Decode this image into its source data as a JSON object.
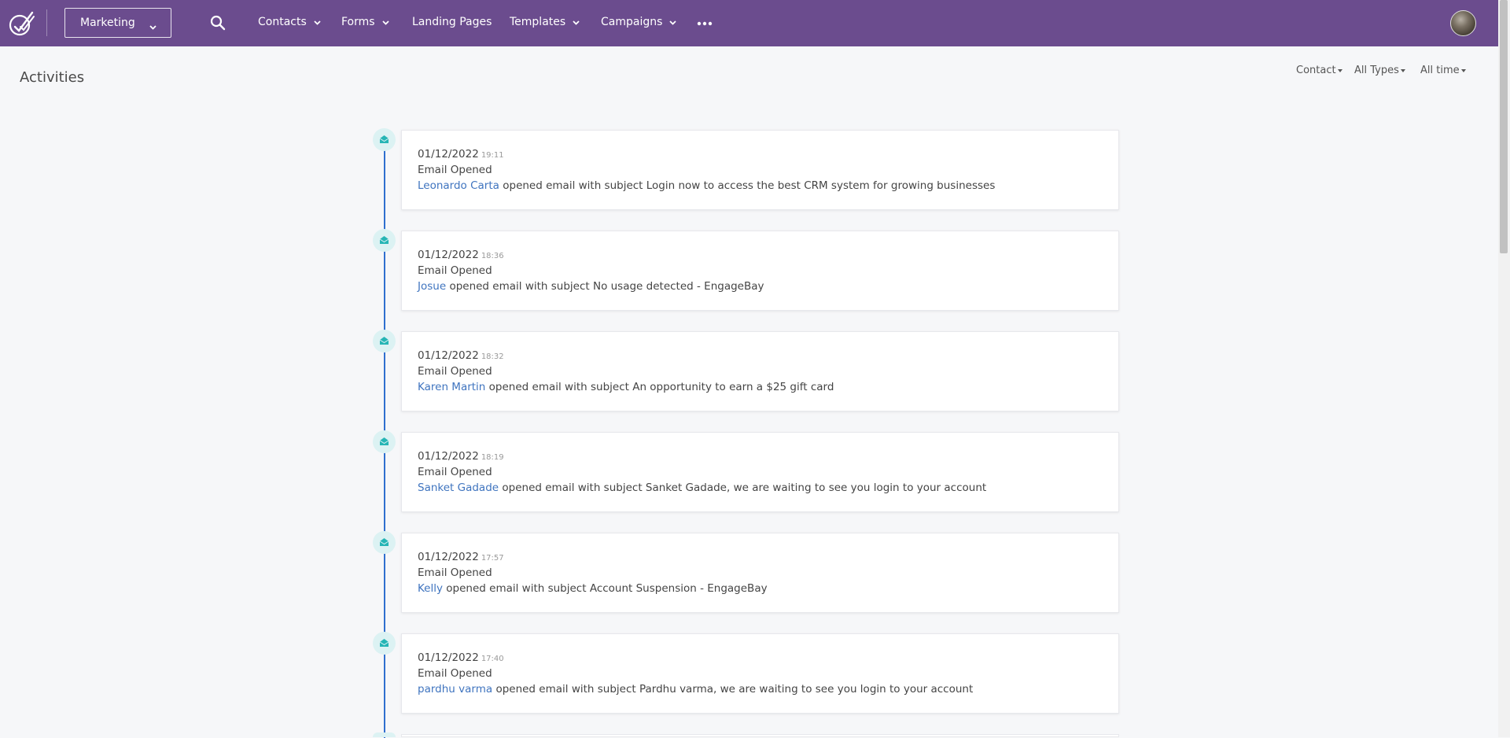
{
  "nav": {
    "app_selector": "Marketing",
    "items": [
      {
        "label": "Contacts",
        "has_dropdown": true
      },
      {
        "label": "Forms",
        "has_dropdown": true
      },
      {
        "label": "Landing Pages",
        "has_dropdown": false
      },
      {
        "label": "Templates",
        "has_dropdown": true
      },
      {
        "label": "Campaigns",
        "has_dropdown": true
      }
    ],
    "icons": [
      "logo-icon",
      "search-icon",
      "more-icon",
      "avatar"
    ]
  },
  "page": {
    "title": "Activities",
    "filters": [
      {
        "label": "Contact"
      },
      {
        "label": "All Types"
      },
      {
        "label": "All time"
      }
    ]
  },
  "activities": [
    {
      "date": "01/12/2022",
      "time": "19:11",
      "type": "Email Opened",
      "contact": "Leonardo Carta",
      "text": "opened email with subject Login now to access the best CRM system for growing businesses"
    },
    {
      "date": "01/12/2022",
      "time": "18:36",
      "type": "Email Opened",
      "contact": "Josue",
      "text": "opened email with subject No usage detected - EngageBay"
    },
    {
      "date": "01/12/2022",
      "time": "18:32",
      "type": "Email Opened",
      "contact": "Karen Martin",
      "text": "opened email with subject An opportunity to earn a $25 gift card"
    },
    {
      "date": "01/12/2022",
      "time": "18:19",
      "type": "Email Opened",
      "contact": "Sanket Gadade",
      "text": "opened email with subject Sanket Gadade, we are waiting to see you login to your account"
    },
    {
      "date": "01/12/2022",
      "time": "17:57",
      "type": "Email Opened",
      "contact": "Kelly",
      "text": "opened email with subject Account Suspension - EngageBay"
    },
    {
      "date": "01/12/2022",
      "time": "17:40",
      "type": "Email Opened",
      "contact": "pardhu varma",
      "text": "opened email with subject Pardhu varma, we are waiting to see you login to your account"
    }
  ],
  "colors": {
    "topbar": "#6b4c8e",
    "link": "#3f74bf",
    "timeline": "#2f6fcf",
    "icon_bg": "#dcf2f3",
    "icon_fg": "#26b5b5"
  }
}
